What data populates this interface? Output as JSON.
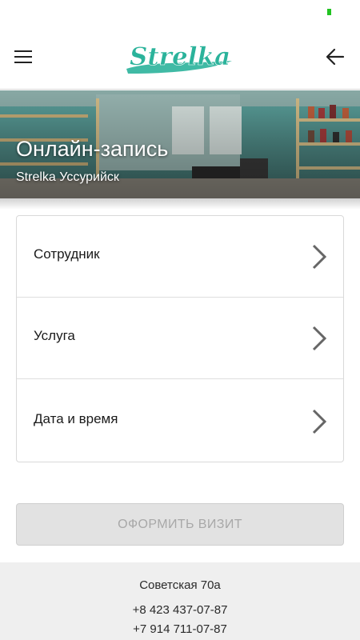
{
  "brand": {
    "logo_text": "Strelka",
    "accent_color": "#2bb39b"
  },
  "header": {
    "menu_icon": "menu-icon",
    "back_icon": "arrow-back-icon"
  },
  "hero": {
    "title": "Онлайн-запись",
    "subtitle": "Strelka Уссурийск"
  },
  "booking_options": [
    {
      "label": "Сотрудник"
    },
    {
      "label": "Услуга"
    },
    {
      "label": "Дата и время"
    }
  ],
  "submit": {
    "label": "ОФОРМИТЬ ВИЗИТ",
    "enabled": false
  },
  "footer": {
    "address": "Советская 70а",
    "phones": [
      "+8 423 437-07-87",
      "+7 914 711-07-87"
    ]
  }
}
